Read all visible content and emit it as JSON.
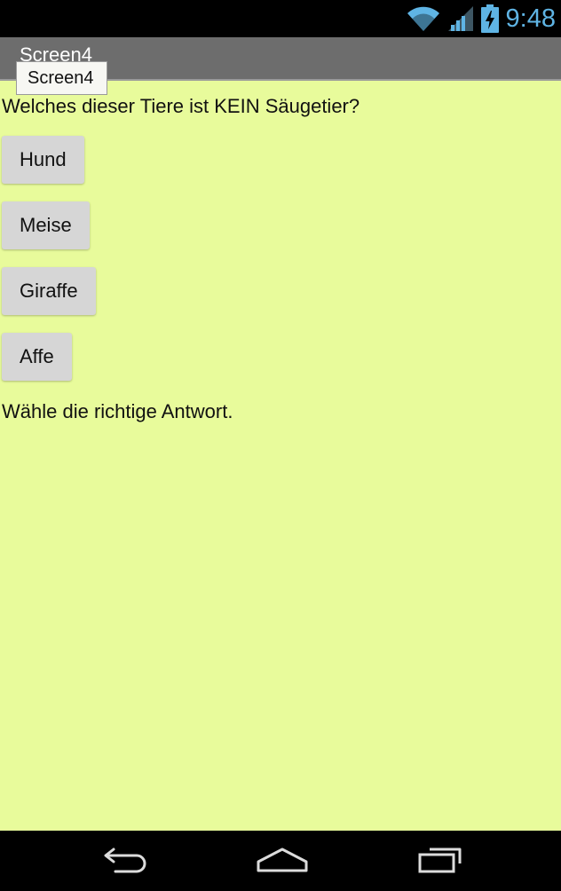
{
  "status_bar": {
    "time": "9:48",
    "icons": [
      "wifi-icon",
      "signal-icon",
      "battery-icon"
    ],
    "accent_color": "#5fb4e4"
  },
  "title_bar": {
    "title": "Screen4",
    "tooltip": "Screen4"
  },
  "main": {
    "question": "Welches dieser Tiere ist KEIN Säugetier?",
    "answers": [
      "Hund",
      "Meise",
      "Giraffe",
      "Affe"
    ],
    "hint": "Wähle die richtige Antwort.",
    "background_color": "#e8fb9b"
  },
  "nav_bar": {
    "icons": [
      "back-icon",
      "home-icon",
      "recent-apps-icon"
    ]
  }
}
